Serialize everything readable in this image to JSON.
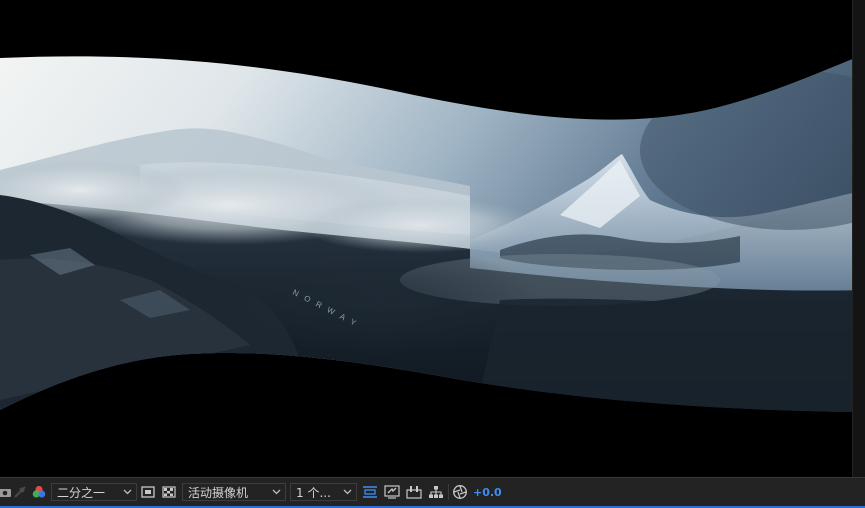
{
  "viewer": {
    "watermark_text": "NORWAY"
  },
  "toolbar": {
    "resolution_value": "二分之一",
    "camera_value": "活动摄像机",
    "views_value": "1 个...",
    "exposure_value": "+0.0"
  },
  "icons": {
    "snapshot": "camera-snapshot-icon",
    "channel": "rgb-channel-icon",
    "region": "region-of-interest-icon",
    "transparency": "transparency-grid-icon",
    "fast_preview": "fast-preview-icon",
    "timeline": "timeline-icon",
    "comp_flowchart": "comp-flowchart-icon",
    "flowchart": "flowchart-icon",
    "exposure_reset": "reset-exposure-icon"
  },
  "colors": {
    "accent": "#2d6fd6",
    "exposure_text": "#3d8ff2",
    "toolbar_bg": "#232323",
    "viewer_bg": "#000000"
  }
}
